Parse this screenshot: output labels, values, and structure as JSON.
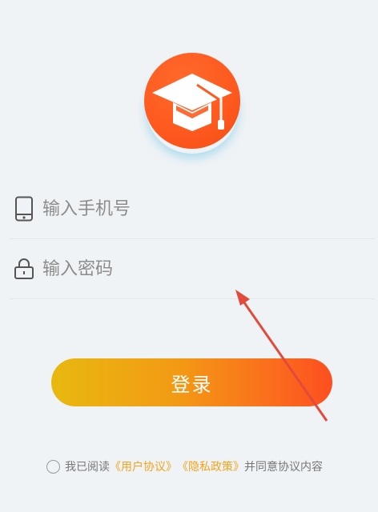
{
  "logo": {
    "icon": "graduation-cap-icon",
    "color": "#ff5a1f"
  },
  "phone_field": {
    "placeholder": "输入手机号",
    "value": "",
    "icon": "phone-icon"
  },
  "password_field": {
    "placeholder": "输入密码",
    "value": "",
    "icon": "lock-icon"
  },
  "login_button": {
    "label": "登录"
  },
  "agreement": {
    "prefix": "我已阅读",
    "user_agreement": "《用户协议》",
    "privacy_policy": "《隐私政策》",
    "suffix": "并同意协议内容",
    "checked": false
  },
  "colors": {
    "background": "#f0f3f6",
    "accent": "#f0a41c",
    "button_start": "#e8b90f",
    "button_end": "#fd4f1f",
    "annotation_arrow": "#e24a3b"
  }
}
